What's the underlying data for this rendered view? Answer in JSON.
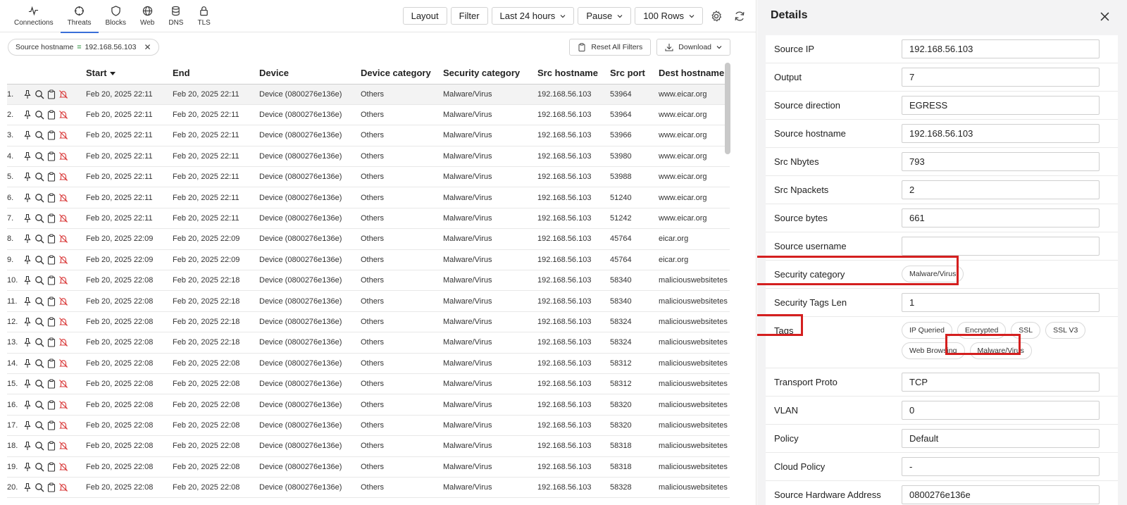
{
  "nav": {
    "tabs": [
      {
        "label": "Connections",
        "icon": "activity-icon",
        "active": false
      },
      {
        "label": "Threats",
        "icon": "crosshair-icon",
        "active": true
      },
      {
        "label": "Blocks",
        "icon": "shield-icon",
        "active": false
      },
      {
        "label": "Web",
        "icon": "globe-icon",
        "active": false
      },
      {
        "label": "DNS",
        "icon": "database-icon",
        "active": false
      },
      {
        "label": "TLS",
        "icon": "lock-icon",
        "active": false
      }
    ]
  },
  "toolbar": {
    "layout": "Layout",
    "filter": "Filter",
    "time_range": "Last 24 hours",
    "pause": "Pause",
    "rows": "100 Rows"
  },
  "filters": {
    "chip_field": "Source hostname",
    "chip_op": "=",
    "chip_value": "192.168.56.103",
    "reset": "Reset All Filters",
    "download": "Download"
  },
  "table": {
    "columns": [
      "Start",
      "End",
      "Device",
      "Device category",
      "Security category",
      "Src hostname",
      "Src port",
      "Dest hostname"
    ],
    "rows": [
      {
        "n": "1.",
        "start": "Feb 20, 2025 22:11",
        "end": "Feb 20, 2025 22:11",
        "device": "Device (0800276e136e)",
        "dcat": "Others",
        "scat": "Malware/Virus",
        "shost": "192.168.56.103",
        "sport": "53964",
        "dhost": "www.eicar.org"
      },
      {
        "n": "2.",
        "start": "Feb 20, 2025 22:11",
        "end": "Feb 20, 2025 22:11",
        "device": "Device (0800276e136e)",
        "dcat": "Others",
        "scat": "Malware/Virus",
        "shost": "192.168.56.103",
        "sport": "53964",
        "dhost": "www.eicar.org"
      },
      {
        "n": "3.",
        "start": "Feb 20, 2025 22:11",
        "end": "Feb 20, 2025 22:11",
        "device": "Device (0800276e136e)",
        "dcat": "Others",
        "scat": "Malware/Virus",
        "shost": "192.168.56.103",
        "sport": "53966",
        "dhost": "www.eicar.org"
      },
      {
        "n": "4.",
        "start": "Feb 20, 2025 22:11",
        "end": "Feb 20, 2025 22:11",
        "device": "Device (0800276e136e)",
        "dcat": "Others",
        "scat": "Malware/Virus",
        "shost": "192.168.56.103",
        "sport": "53980",
        "dhost": "www.eicar.org"
      },
      {
        "n": "5.",
        "start": "Feb 20, 2025 22:11",
        "end": "Feb 20, 2025 22:11",
        "device": "Device (0800276e136e)",
        "dcat": "Others",
        "scat": "Malware/Virus",
        "shost": "192.168.56.103",
        "sport": "53988",
        "dhost": "www.eicar.org"
      },
      {
        "n": "6.",
        "start": "Feb 20, 2025 22:11",
        "end": "Feb 20, 2025 22:11",
        "device": "Device (0800276e136e)",
        "dcat": "Others",
        "scat": "Malware/Virus",
        "shost": "192.168.56.103",
        "sport": "51240",
        "dhost": "www.eicar.org"
      },
      {
        "n": "7.",
        "start": "Feb 20, 2025 22:11",
        "end": "Feb 20, 2025 22:11",
        "device": "Device (0800276e136e)",
        "dcat": "Others",
        "scat": "Malware/Virus",
        "shost": "192.168.56.103",
        "sport": "51242",
        "dhost": "www.eicar.org"
      },
      {
        "n": "8.",
        "start": "Feb 20, 2025 22:09",
        "end": "Feb 20, 2025 22:09",
        "device": "Device (0800276e136e)",
        "dcat": "Others",
        "scat": "Malware/Virus",
        "shost": "192.168.56.103",
        "sport": "45764",
        "dhost": "eicar.org"
      },
      {
        "n": "9.",
        "start": "Feb 20, 2025 22:09",
        "end": "Feb 20, 2025 22:09",
        "device": "Device (0800276e136e)",
        "dcat": "Others",
        "scat": "Malware/Virus",
        "shost": "192.168.56.103",
        "sport": "45764",
        "dhost": "eicar.org"
      },
      {
        "n": "10.",
        "start": "Feb 20, 2025 22:08",
        "end": "Feb 20, 2025 22:18",
        "device": "Device (0800276e136e)",
        "dcat": "Others",
        "scat": "Malware/Virus",
        "shost": "192.168.56.103",
        "sport": "58340",
        "dhost": "maliciouswebsitetes"
      },
      {
        "n": "11.",
        "start": "Feb 20, 2025 22:08",
        "end": "Feb 20, 2025 22:18",
        "device": "Device (0800276e136e)",
        "dcat": "Others",
        "scat": "Malware/Virus",
        "shost": "192.168.56.103",
        "sport": "58340",
        "dhost": "maliciouswebsitetes"
      },
      {
        "n": "12.",
        "start": "Feb 20, 2025 22:08",
        "end": "Feb 20, 2025 22:18",
        "device": "Device (0800276e136e)",
        "dcat": "Others",
        "scat": "Malware/Virus",
        "shost": "192.168.56.103",
        "sport": "58324",
        "dhost": "maliciouswebsitetes"
      },
      {
        "n": "13.",
        "start": "Feb 20, 2025 22:08",
        "end": "Feb 20, 2025 22:18",
        "device": "Device (0800276e136e)",
        "dcat": "Others",
        "scat": "Malware/Virus",
        "shost": "192.168.56.103",
        "sport": "58324",
        "dhost": "maliciouswebsitetes"
      },
      {
        "n": "14.",
        "start": "Feb 20, 2025 22:08",
        "end": "Feb 20, 2025 22:08",
        "device": "Device (0800276e136e)",
        "dcat": "Others",
        "scat": "Malware/Virus",
        "shost": "192.168.56.103",
        "sport": "58312",
        "dhost": "maliciouswebsitetes"
      },
      {
        "n": "15.",
        "start": "Feb 20, 2025 22:08",
        "end": "Feb 20, 2025 22:08",
        "device": "Device (0800276e136e)",
        "dcat": "Others",
        "scat": "Malware/Virus",
        "shost": "192.168.56.103",
        "sport": "58312",
        "dhost": "maliciouswebsitetes"
      },
      {
        "n": "16.",
        "start": "Feb 20, 2025 22:08",
        "end": "Feb 20, 2025 22:08",
        "device": "Device (0800276e136e)",
        "dcat": "Others",
        "scat": "Malware/Virus",
        "shost": "192.168.56.103",
        "sport": "58320",
        "dhost": "maliciouswebsitetes"
      },
      {
        "n": "17.",
        "start": "Feb 20, 2025 22:08",
        "end": "Feb 20, 2025 22:08",
        "device": "Device (0800276e136e)",
        "dcat": "Others",
        "scat": "Malware/Virus",
        "shost": "192.168.56.103",
        "sport": "58320",
        "dhost": "maliciouswebsitetes"
      },
      {
        "n": "18.",
        "start": "Feb 20, 2025 22:08",
        "end": "Feb 20, 2025 22:08",
        "device": "Device (0800276e136e)",
        "dcat": "Others",
        "scat": "Malware/Virus",
        "shost": "192.168.56.103",
        "sport": "58318",
        "dhost": "maliciouswebsitetes"
      },
      {
        "n": "19.",
        "start": "Feb 20, 2025 22:08",
        "end": "Feb 20, 2025 22:08",
        "device": "Device (0800276e136e)",
        "dcat": "Others",
        "scat": "Malware/Virus",
        "shost": "192.168.56.103",
        "sport": "58318",
        "dhost": "maliciouswebsitetes"
      },
      {
        "n": "20.",
        "start": "Feb 20, 2025 22:08",
        "end": "Feb 20, 2025 22:08",
        "device": "Device (0800276e136e)",
        "dcat": "Others",
        "scat": "Malware/Virus",
        "shost": "192.168.56.103",
        "sport": "58328",
        "dhost": "maliciouswebsitetes"
      }
    ]
  },
  "details": {
    "title": "Details",
    "fields": [
      {
        "label": "Source IP",
        "value": "192.168.56.103"
      },
      {
        "label": "Output",
        "value": "7"
      },
      {
        "label": "Source direction",
        "value": "EGRESS"
      },
      {
        "label": "Source hostname",
        "value": "192.168.56.103"
      },
      {
        "label": "Src Nbytes",
        "value": "793"
      },
      {
        "label": "Src Npackets",
        "value": "2"
      },
      {
        "label": "Source bytes",
        "value": "661"
      },
      {
        "label": "Source username",
        "value": ""
      },
      {
        "label": "Security category",
        "pills": [
          "Malware/Virus"
        ]
      },
      {
        "label": "Security Tags Len",
        "value": "1"
      },
      {
        "label": "Tags",
        "pills": [
          "IP Queried",
          "Encrypted",
          "SSL",
          "SSL V3",
          "Web Browsing",
          "Malware/Virus"
        ]
      },
      {
        "label": "Transport Proto",
        "value": "TCP"
      },
      {
        "label": "VLAN",
        "value": "0"
      },
      {
        "label": "Policy",
        "value": "Default"
      },
      {
        "label": "Cloud Policy",
        "value": "-"
      },
      {
        "label": "Source Hardware Address",
        "value": "0800276e136e"
      }
    ]
  },
  "colors": {
    "accent": "#3a6fd8",
    "highlight_box": "#d41f1f",
    "block_icon": "#d93a3a",
    "filter_eq": "#3a9a4b"
  }
}
